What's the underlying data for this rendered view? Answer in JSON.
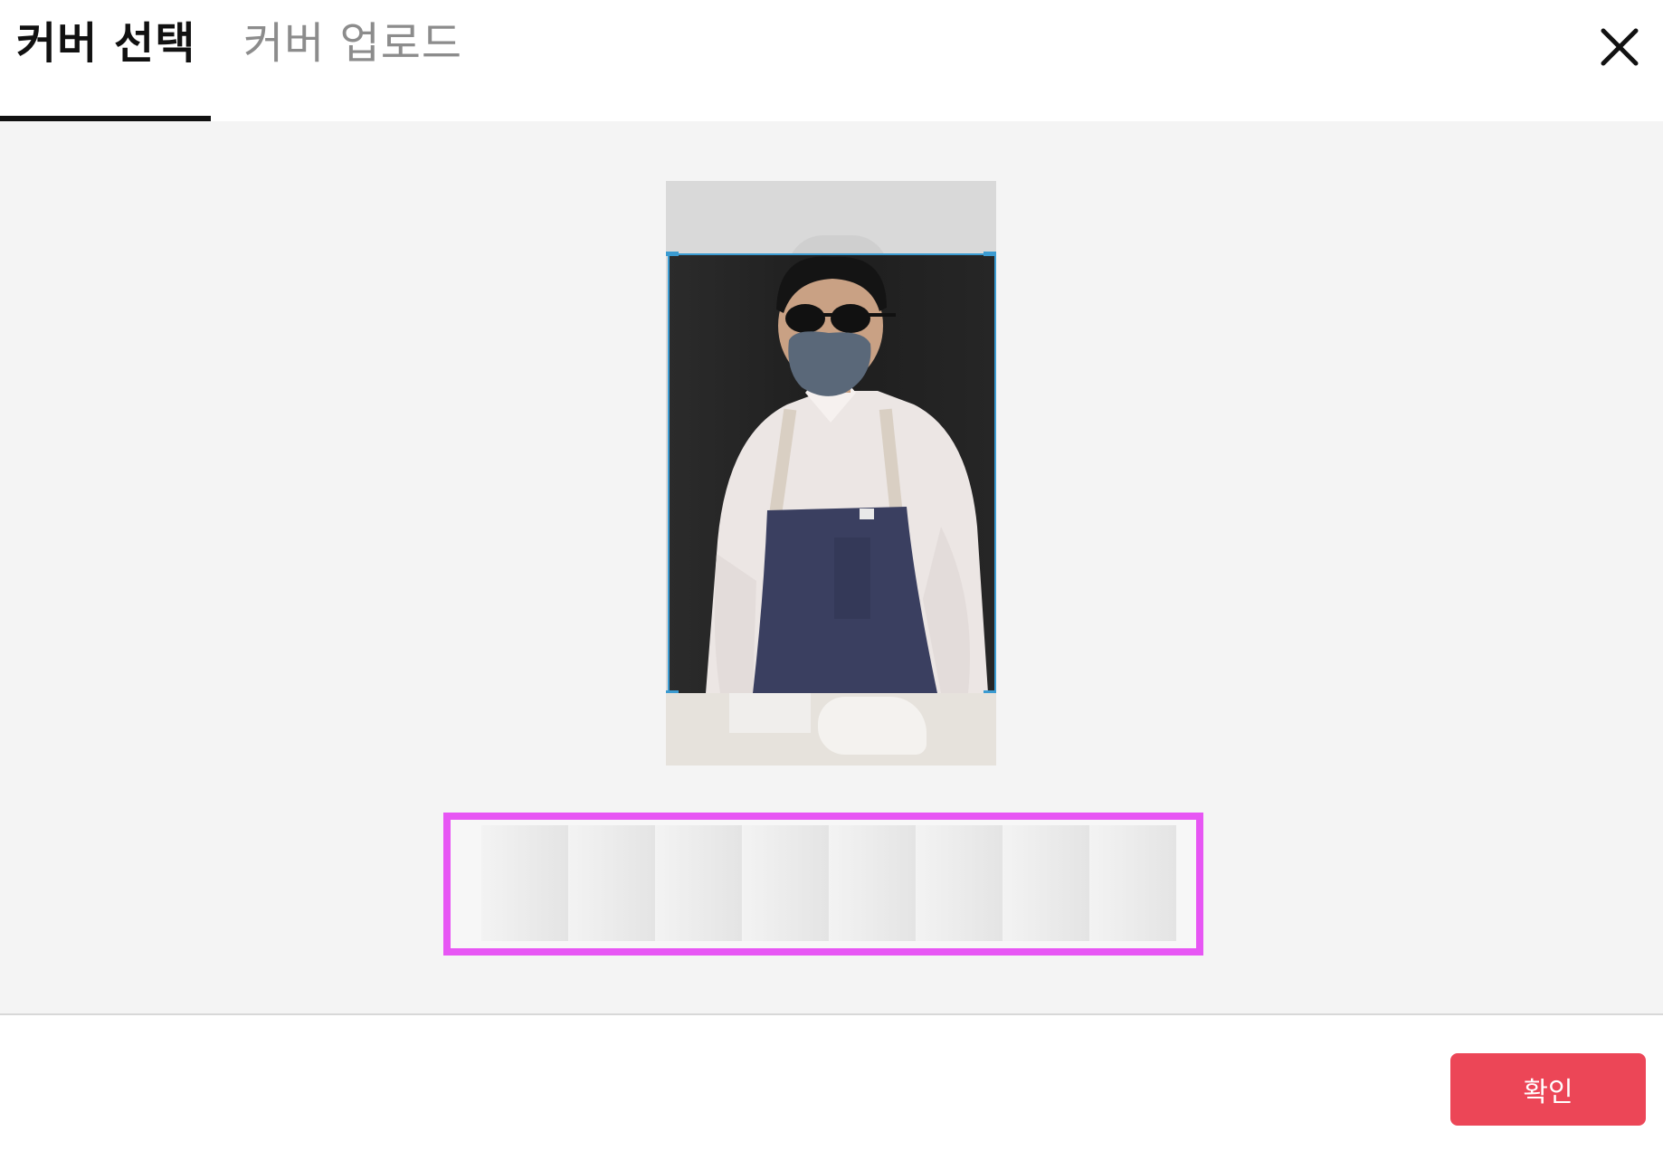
{
  "tabs": {
    "select_label": "커버 선택",
    "upload_label": "커버 업로드",
    "active": "select"
  },
  "header": {
    "close_icon": "close-icon"
  },
  "preview": {
    "crop_color": "#3b9bd1"
  },
  "filmstrip": {
    "highlight_color": "#e756f4",
    "frames": [
      "",
      "",
      "",
      "",
      "",
      "",
      "",
      ""
    ]
  },
  "footer": {
    "confirm_label": "확인",
    "confirm_color": "#ec4657"
  }
}
